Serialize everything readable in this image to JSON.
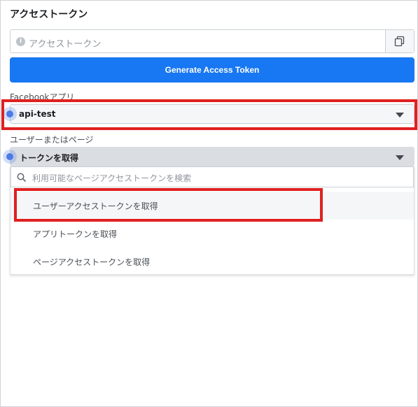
{
  "title": "アクセストークン",
  "token_field": {
    "placeholder": "アクセストークン",
    "info_icon": "info-icon",
    "copy_icon": "copy-icon"
  },
  "generate_button": "Generate Access Token",
  "app_select": {
    "label": "Facebookアプリ",
    "value": "api-test"
  },
  "user_page_select": {
    "label": "ユーザーまたはページ",
    "value": "トークンを取得"
  },
  "dropdown": {
    "search_placeholder": "利用可能なページアクセストークンを検索",
    "options": [
      "ユーザーアクセストークンを取得",
      "アプリトークンを取得",
      "ページアクセストークンを取得"
    ]
  },
  "colors": {
    "primary": "#1877f2",
    "highlight_box": "#e02020",
    "indicator": "#4c7be8"
  }
}
